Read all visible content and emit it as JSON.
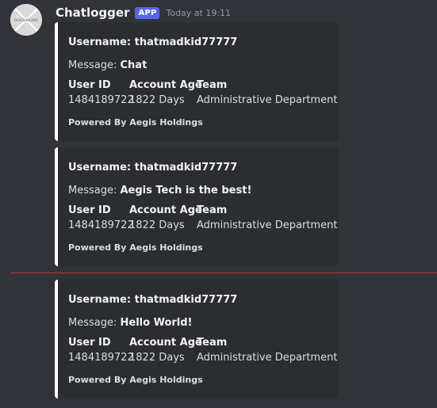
{
  "header": {
    "bot_name": "Chatlogger",
    "badge": "APP",
    "timestamp": "Today at 19:11",
    "avatar_text": "PLACEHOLDER"
  },
  "embeds": [
    {
      "title": "Username: thatmadkid77777",
      "message_label": "Message: ",
      "message": "Chat",
      "fields": [
        {
          "name": "User ID",
          "value": "1484189722"
        },
        {
          "name": "Account Age",
          "value": "1822 Days"
        },
        {
          "name": "Team",
          "value": "Administrative Department"
        }
      ],
      "footer": "Powered By Aegis Holdings"
    },
    {
      "title": "Username: thatmadkid77777",
      "message_label": "Message: ",
      "message": "Aegis Tech is the best!",
      "fields": [
        {
          "name": "User ID",
          "value": "1484189722"
        },
        {
          "name": "Account Age",
          "value": "1822 Days"
        },
        {
          "name": "Team",
          "value": "Administrative Department"
        }
      ],
      "footer": "Powered By Aegis Holdings"
    },
    {
      "title": "Username: thatmadkid77777",
      "message_label": "Message: ",
      "message": "Hello World!",
      "fields": [
        {
          "name": "User ID",
          "value": "1484189722"
        },
        {
          "name": "Account Age",
          "value": "1822 Days"
        },
        {
          "name": "Team",
          "value": "Administrative Department"
        }
      ],
      "footer": "Powered By Aegis Holdings"
    }
  ],
  "colors": {
    "background": "#313338",
    "embed_background": "#2b2d31",
    "embed_accent": "#ffffff",
    "badge": "#5865f2",
    "new_message_divider": "#b73a3e"
  }
}
